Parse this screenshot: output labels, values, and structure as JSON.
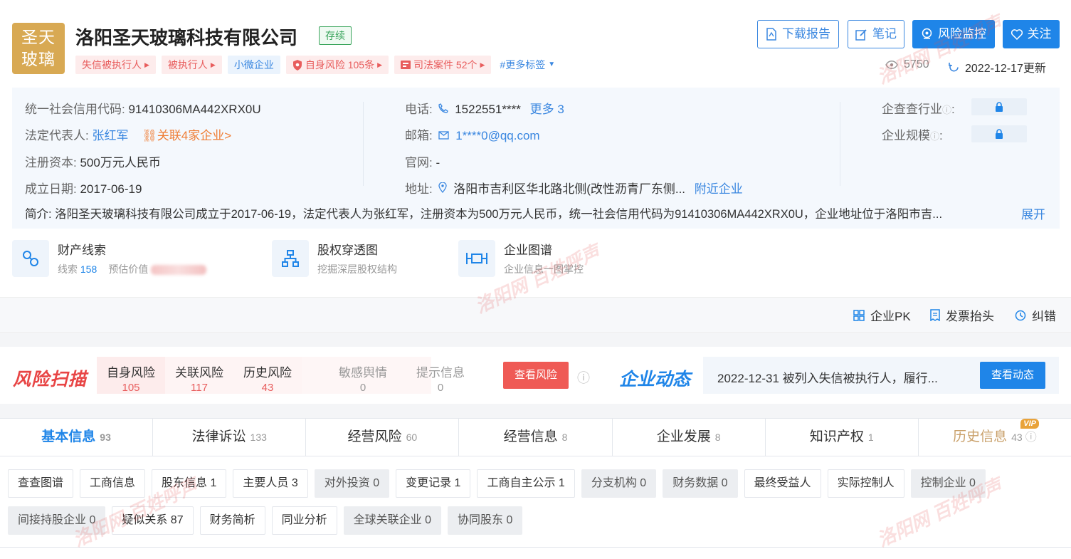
{
  "header": {
    "logo_line1": "圣天",
    "logo_line2": "玻璃",
    "company_name": "洛阳圣天玻璃科技有限公司",
    "status": "存续",
    "tags": [
      "失信被执行人",
      "被执行人",
      "小微企业",
      "自身风险 105条",
      "司法案件 52个"
    ],
    "more_tags": "#更多标签",
    "buttons": {
      "download": "下载报告",
      "notes": "笔记",
      "monitor": "风险监控",
      "follow": "关注"
    },
    "views": "5750",
    "updated": "2022-12-17更新"
  },
  "info": {
    "credit_code_label": "统一社会信用代码:",
    "credit_code": "91410306MA442XRX0U",
    "legal_rep_label": "法定代表人:",
    "legal_rep": "张红军",
    "related": "关联4家企业>",
    "capital_label": "注册资本:",
    "capital": "500万元人民币",
    "founded_label": "成立日期:",
    "founded": "2017-06-19",
    "phone_label": "电话:",
    "phone": "1522551****",
    "phone_more": "更多 3",
    "email_label": "邮箱:",
    "email": "1****0@qq.com",
    "website_label": "官网:",
    "website": "-",
    "address_label": "地址:",
    "address": "洛阳市吉利区华北路北侧(改性沥青厂东侧...",
    "nearby": "附近企业",
    "industry_label": "企查查行业",
    "scale_label": "企业规模",
    "colon": ":",
    "intro": "简介: 洛阳圣天玻璃科技有限公司成立于2017-06-19，法定代表人为张红军，注册资本为500万元人民币，统一社会信用代码为91410306MA442XRX0U，企业地址位于洛阳市吉...",
    "expand": "展开"
  },
  "tools": [
    {
      "title": "财产线索",
      "sub_label": "线索",
      "sub_value": "158",
      "sub_extra": "预估价值"
    },
    {
      "title": "股权穿透图",
      "sub": "挖掘深层股权结构"
    },
    {
      "title": "企业图谱",
      "sub": "企业信息一图掌控"
    }
  ],
  "actions": {
    "pk": "企业PK",
    "invoice": "发票抬头",
    "correct": "纠错"
  },
  "risk": {
    "logo": "风险扫描",
    "items": [
      {
        "label": "自身风险",
        "count": "105"
      },
      {
        "label": "关联风险",
        "count": "117"
      },
      {
        "label": "历史风险",
        "count": "43"
      },
      {
        "label": "敏感舆情",
        "count": "0"
      },
      {
        "label": "提示信息",
        "count": "0"
      }
    ],
    "button": "查看风险"
  },
  "dynamics": {
    "logo": "企业动态",
    "text": "2022-12-31 被列入失信被执行人，履行...",
    "button": "查看动态"
  },
  "tabs": [
    {
      "label": "基本信息",
      "count": "93"
    },
    {
      "label": "法律诉讼",
      "count": "133"
    },
    {
      "label": "经营风险",
      "count": "60"
    },
    {
      "label": "经营信息",
      "count": "8"
    },
    {
      "label": "企业发展",
      "count": "8"
    },
    {
      "label": "知识产权",
      "count": "1"
    },
    {
      "label": "历史信息",
      "count": "43",
      "badge": "VIP"
    }
  ],
  "chips_row1": [
    "查查图谱",
    "工商信息",
    "股东信息 1",
    "主要人员 3",
    "对外投资 0",
    "变更记录 1",
    "工商自主公示 1",
    "分支机构 0",
    "财务数据 0",
    "最终受益人",
    "实际控制人",
    "控制企业 0"
  ],
  "chips_row2": [
    "间接持股企业 0",
    "疑似关系 87",
    "财务简析",
    "同业分析",
    "全球关联企业 0",
    "协同股东 0"
  ],
  "watermark": "洛阳网 百姓呼声",
  "colors": {
    "primary": "#1f85e8",
    "danger": "#e85d5d",
    "success": "#3ba55d",
    "gold": "#d8a953"
  }
}
